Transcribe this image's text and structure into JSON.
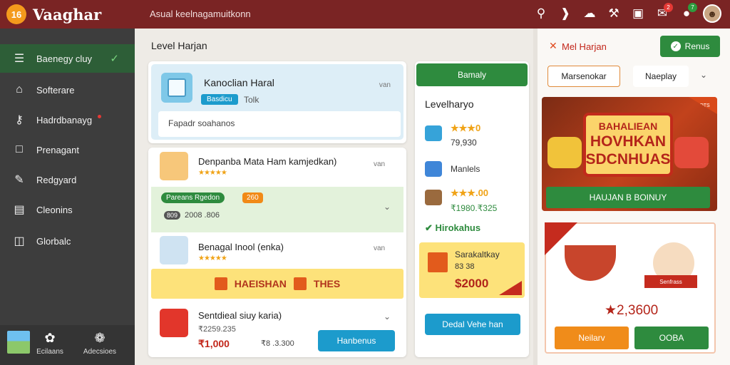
{
  "app": {
    "logo_mark": "16",
    "title": "Vaaghar",
    "search_placeholder": "Asual keelnagamuitkonn"
  },
  "topbar": {
    "badge_red": "2",
    "badge_green": "7"
  },
  "sidebar": {
    "items": [
      {
        "label": "Baenegy cluy",
        "icon": "list-icon"
      },
      {
        "label": "Softerare",
        "icon": "home-icon"
      },
      {
        "label": "Hadrdbanayg",
        "icon": "key-icon"
      },
      {
        "label": "Prenagant",
        "icon": "monitor-icon"
      },
      {
        "label": "Redgyard",
        "icon": "pencil-icon"
      },
      {
        "label": "Cleonins",
        "icon": "file-icon"
      },
      {
        "label": "Glorbalc",
        "icon": "briefcase-icon"
      }
    ],
    "bottom": [
      {
        "label": "Ecilaans"
      },
      {
        "label": "Adecsioes"
      }
    ]
  },
  "main": {
    "title": "Level Harjan",
    "level_card": {
      "name": "Kanoclian Haral",
      "pill": "Basdicu",
      "tag": "Tolk",
      "more": "van",
      "input_value": "Fapadr soahanos"
    },
    "list": {
      "row1": {
        "title": "Denpanba Mata Ham kamjedkan)",
        "stars": "★★★★★",
        "more": "van"
      },
      "green": {
        "pill": "Pareans Rgedon",
        "badge": "260",
        "val1": "809",
        "val2": "2008 .806"
      },
      "row2": {
        "title": "Benagal Inool (enka)",
        "stars": "★★★★★",
        "more": "van"
      },
      "yellow": {
        "left": "HAEISHAN",
        "right": "THES"
      },
      "row3": {
        "title": "Sentdieal siuy karia)",
        "sub": "₹2259.235",
        "price": "₹1,000",
        "price2": "₹8 .3.300",
        "button": "Hanbenus"
      }
    }
  },
  "rewards": {
    "button": "Bamaly",
    "title": "Levelharyo",
    "item1": {
      "stars": "★★★0",
      "value": "79,930"
    },
    "item2": {
      "label": "Manlels"
    },
    "item3": {
      "stars": "★★★.00",
      "value": "₹1980.₹325"
    },
    "green_label": "Hirokahus",
    "box": {
      "title": "Sarakaltkay",
      "sub": "83 38",
      "value": "$2000"
    },
    "bottom_button": "Dedal Vehe han"
  },
  "right_panel": {
    "title": "Mel Harjan",
    "bonus_button": "Renus",
    "tab1": "Marsenokar",
    "tab2": "Naeplay",
    "banner": {
      "line1": "BAHALIEAN",
      "line2": "HOVHKAN SDCNHUAS",
      "button": "HAUJAN B BOINUY",
      "corner": "HOTS"
    },
    "promo": {
      "label": "Senfrass",
      "value": "★2,3600",
      "btn_left": "Neilarv",
      "btn_right": "OOBA"
    }
  }
}
